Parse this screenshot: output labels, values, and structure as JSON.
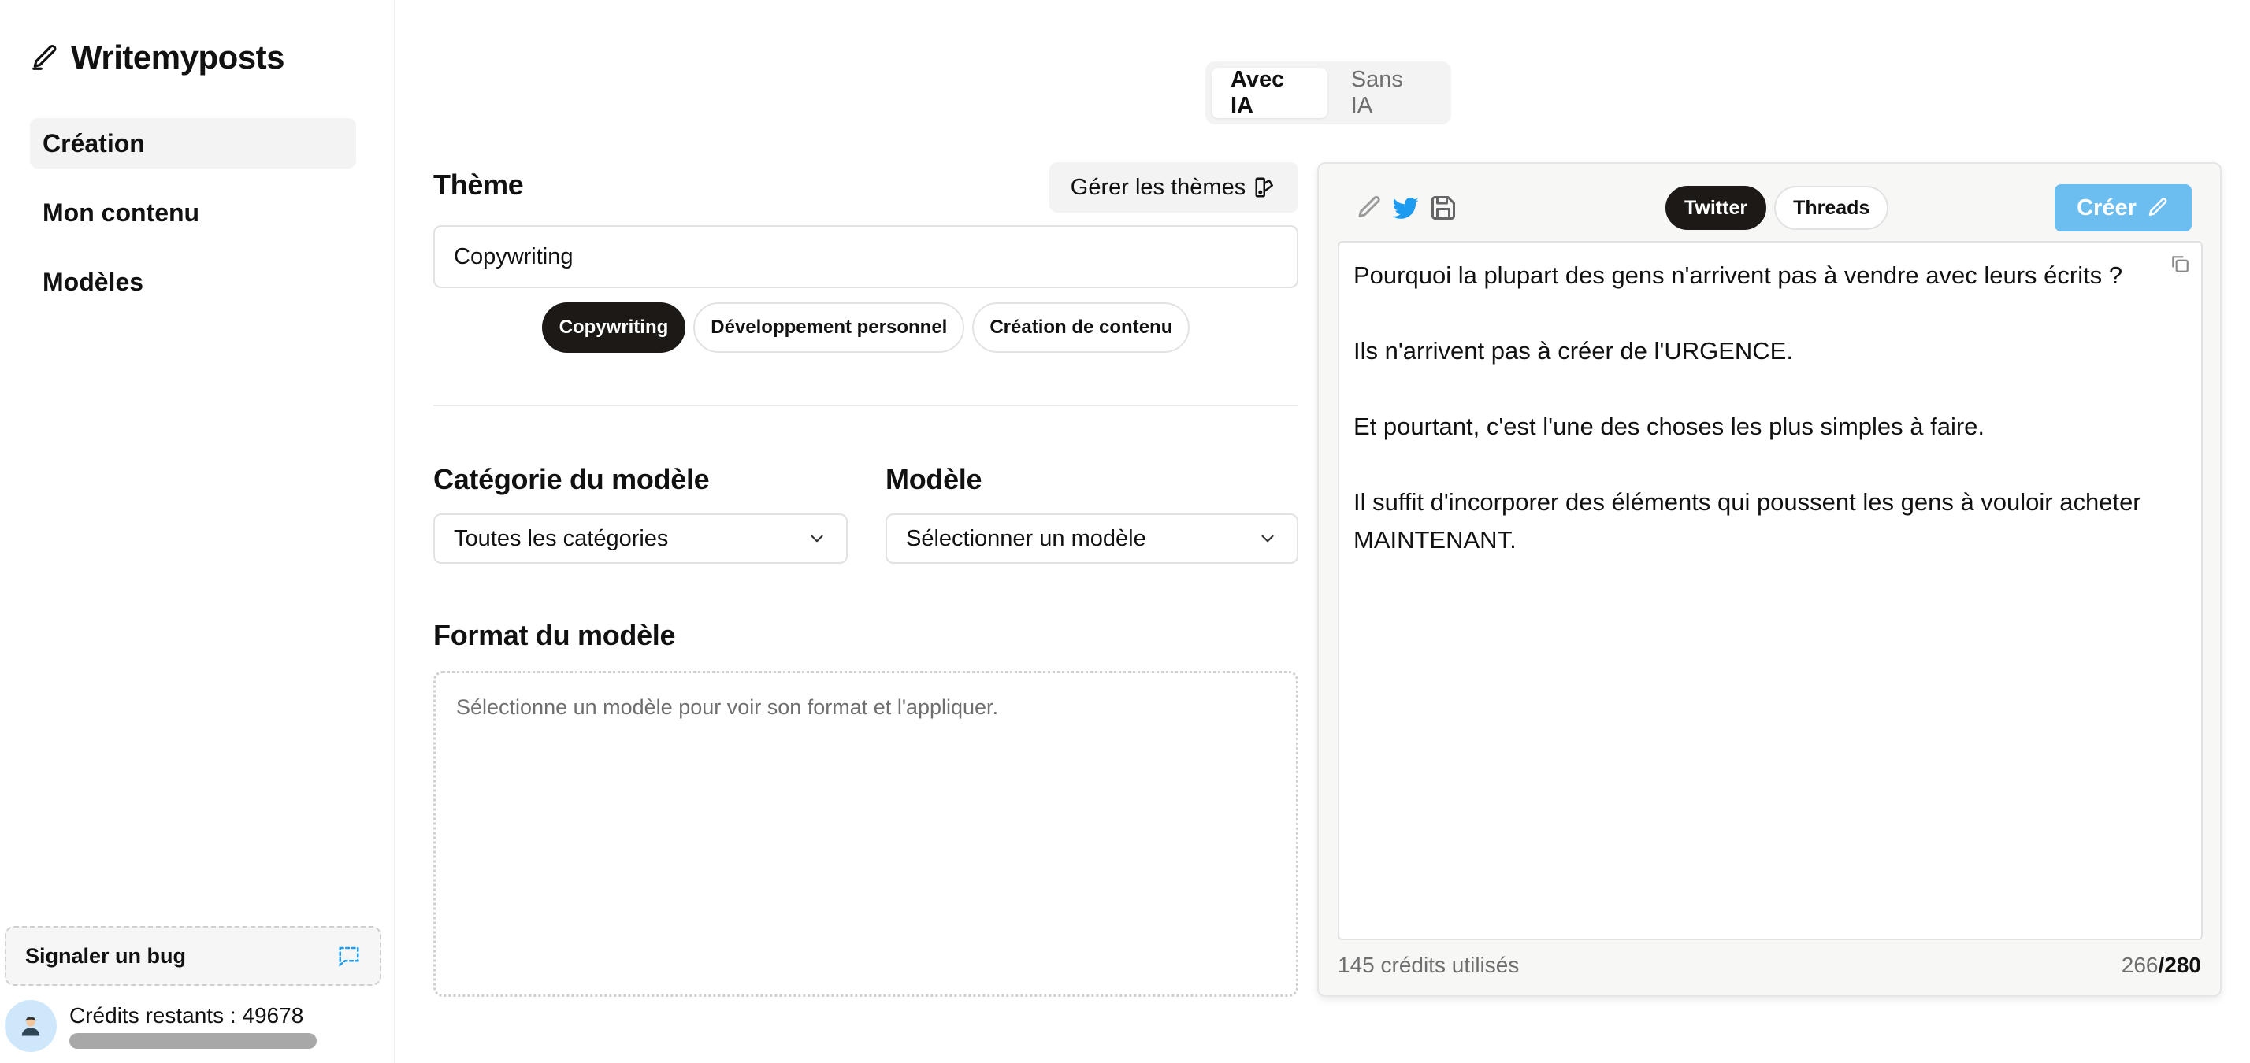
{
  "app": {
    "name": "Writemyposts"
  },
  "sidebar": {
    "nav": [
      {
        "label": "Création",
        "active": true
      },
      {
        "label": "Mon contenu",
        "active": false
      },
      {
        "label": "Modèles",
        "active": false
      }
    ],
    "bug_label": "Signaler un bug",
    "credits": {
      "label": "Crédits restants : 49678",
      "progress_percent": 100
    }
  },
  "mode": {
    "with_ai": "Avec IA",
    "without_ai": "Sans IA",
    "selected": "with_ai"
  },
  "theme": {
    "title": "Thème",
    "manage_label": "Gérer les thèmes",
    "input_value": "Copywriting",
    "chips": [
      {
        "label": "Copywriting",
        "active": true
      },
      {
        "label": "Développement personnel",
        "active": false
      },
      {
        "label": "Création de contenu",
        "active": false
      }
    ]
  },
  "template": {
    "category_title": "Catégorie du modèle",
    "category_value": "Toutes les catégories",
    "model_title": "Modèle",
    "model_value": "Sélectionner un modèle",
    "format_title": "Format du modèle",
    "format_placeholder": "Sélectionne un modèle pour voir son format et l'appliquer."
  },
  "editor": {
    "platforms": [
      {
        "label": "Twitter",
        "active": true
      },
      {
        "label": "Threads",
        "active": false
      }
    ],
    "create_label": "Créer",
    "paragraphs": [
      "Pourquoi la plupart des gens n'arrivent pas à vendre avec leurs écrits ?",
      "Ils n'arrivent pas à créer de l'URGENCE.",
      "Et pourtant, c'est l'une des choses les plus simples à faire.",
      "Il suffit d'incorporer des éléments qui poussent les gens à vouloir acheter MAINTENANT."
    ],
    "credits_used": "145 crédits utilisés",
    "char_count": "266",
    "char_separator": "/",
    "char_limit": "280"
  },
  "colors": {
    "accent": "#6cbdf0",
    "dark": "#1c1917",
    "twitter": "#1d9bf0"
  }
}
